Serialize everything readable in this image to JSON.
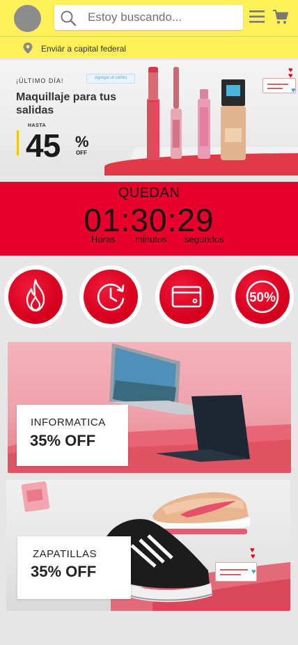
{
  "header": {
    "search_placeholder": "Estoy buscando..."
  },
  "location": {
    "text": "Enviár a capital federal"
  },
  "banner_makeup": {
    "eyebrow": "¡ÚLTIMO DÍA!",
    "title": "Maquillaje para tus salidas",
    "hasta": "HASTA",
    "percent": "45",
    "percent_sign": "%",
    "off": "OFF",
    "tag": "Agregar al carrito"
  },
  "countdown": {
    "label": "QUEDAN",
    "time": "01:30:29",
    "units": [
      "Horas",
      "minutos",
      "segundos"
    ]
  },
  "categories": [
    {
      "icon": "flame-icon"
    },
    {
      "icon": "clock-icon"
    },
    {
      "icon": "credit-card-icon"
    },
    {
      "icon": "percent-50-icon",
      "label": "50%"
    }
  ],
  "promos": [
    {
      "name": "INFORMATICA",
      "discount": "35% OFF"
    },
    {
      "name": "ZAPATILLAS",
      "discount": "35% OFF"
    }
  ],
  "colors": {
    "header_yellow": "#fff159",
    "countdown_red": "#e8002c",
    "category_red": "#d9001f",
    "promo_pink": "#efa1aa"
  }
}
